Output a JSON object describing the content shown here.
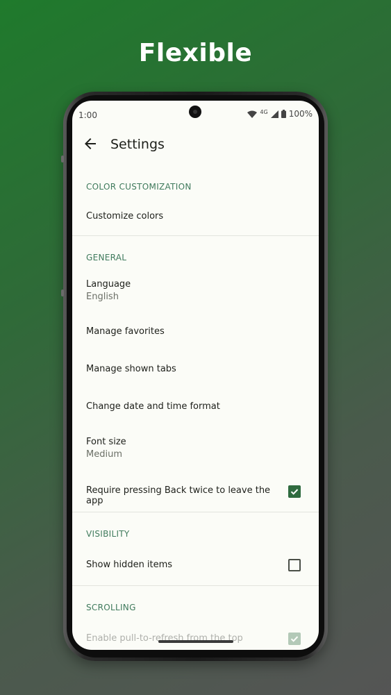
{
  "promo": {
    "headline": "Flexible"
  },
  "status_bar": {
    "time": "1:00",
    "network": "4G",
    "battery": "100%"
  },
  "app_bar": {
    "title": "Settings",
    "back_icon": "arrow-back-icon"
  },
  "sections": {
    "color_customization": {
      "header": "COLOR CUSTOMIZATION",
      "customize_colors": "Customize colors"
    },
    "general": {
      "header": "GENERAL",
      "language_title": "Language",
      "language_value": "English",
      "manage_favorites": "Manage favorites",
      "manage_shown_tabs": "Manage shown tabs",
      "change_date_time": "Change date and time format",
      "font_size_title": "Font size",
      "font_size_value": "Medium",
      "press_back_twice": "Require pressing Back twice to leave the app",
      "press_back_twice_checked": true
    },
    "visibility": {
      "header": "VISIBILITY",
      "show_hidden_items": "Show hidden items",
      "show_hidden_items_checked": false
    },
    "scrolling": {
      "header": "SCROLLING",
      "pull_to_refresh": "Enable pull-to-refresh from the top",
      "pull_to_refresh_checked": true
    }
  },
  "colors": {
    "accent": "#2f6b3f",
    "section_header": "#3f7a5c",
    "screen_background": "#fbfcf7"
  }
}
